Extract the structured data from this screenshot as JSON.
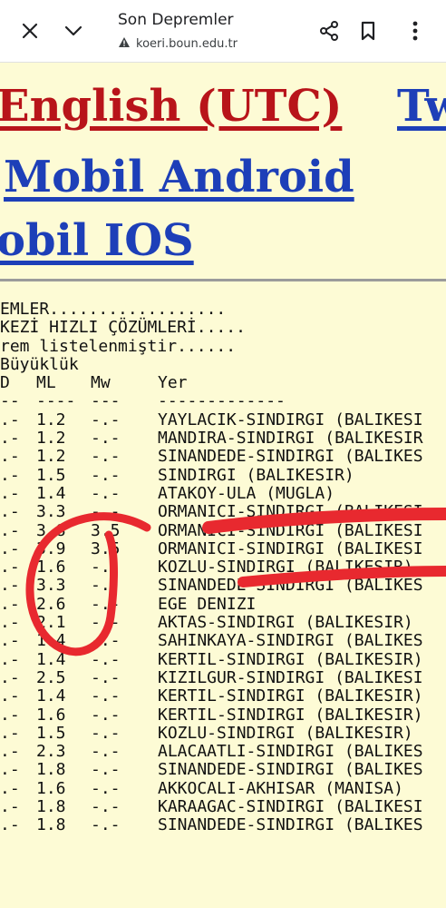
{
  "browser": {
    "page_title": "Son Depremler",
    "url": "koeri.boun.edu.tr",
    "icons": [
      "close-icon",
      "chevron-down-icon",
      "warning-icon",
      "share-icon",
      "bookmark-icon",
      "more-vert-icon"
    ]
  },
  "links": {
    "english": "English (UTC)",
    "twitter_partial": "Tw",
    "mobil_android": "Mobil Android",
    "mobil_ios": "obil IOS"
  },
  "listing": {
    "header_lines": [
      "EMLER..................",
      "KEZİ HIZLI ÇÖZÜMLERİ.....",
      "rem listelenmiştir......",
      "Büyüklük"
    ],
    "columns": {
      "d": "D",
      "ml": "ML",
      "mw": "Mw",
      "place": "Yer"
    },
    "rule": {
      "d": "--",
      "ml": "----",
      "mw": "---",
      "place": "-------------"
    },
    "rows": [
      {
        "d": ".-",
        "ml": "1.2",
        "mw": "-.-",
        "place": "YAYLACIK-SINDIRGI (BALIKESI"
      },
      {
        "d": ".-",
        "ml": "1.2",
        "mw": "-.-",
        "place": "MANDIRA-SINDIRGI (BALIKESIR"
      },
      {
        "d": ".-",
        "ml": "1.2",
        "mw": "-.-",
        "place": "SINANDEDE-SINDIRGI (BALIKES"
      },
      {
        "d": ".-",
        "ml": "1.5",
        "mw": "-.-",
        "place": "SINDIRGI (BALIKESIR)"
      },
      {
        "d": ".-",
        "ml": "1.4",
        "mw": "-.-",
        "place": "ATAKOY-ULA (MUGLA)"
      },
      {
        "d": ".-",
        "ml": "3.3",
        "mw": "-.-",
        "place": "ORMANICI-SINDIRGI (BALIKESI"
      },
      {
        "d": ".-",
        "ml": "3.8",
        "mw": "3.5",
        "place": "ORMANICI-SINDIRGI (BALIKESI"
      },
      {
        "d": ".-",
        "ml": "3.9",
        "mw": "3.5",
        "place": "ORMANICI-SINDIRGI (BALIKESI"
      },
      {
        "d": ".-",
        "ml": "1.6",
        "mw": "-.-",
        "place": "KOZLU-SINDIRGI (BALIKESIR)"
      },
      {
        "d": ".-",
        "ml": "3.3",
        "mw": "-.-",
        "place": "SINANDEDE-SINDIRGI (BALIKES"
      },
      {
        "d": ".-",
        "ml": "2.6",
        "mw": "-.-",
        "place": "EGE DENIZI"
      },
      {
        "d": ".-",
        "ml": "2.1",
        "mw": "-.-",
        "place": "AKTAS-SINDIRGI (BALIKESIR)"
      },
      {
        "d": ".-",
        "ml": "1.4",
        "mw": "-.-",
        "place": "SAHINKAYA-SINDIRGI (BALIKES"
      },
      {
        "d": ".-",
        "ml": "1.4",
        "mw": "-.-",
        "place": "KERTIL-SINDIRGI (BALIKESIR)"
      },
      {
        "d": ".-",
        "ml": "2.5",
        "mw": "-.-",
        "place": "KIZILGUR-SINDIRGI (BALIKESI"
      },
      {
        "d": ".-",
        "ml": "1.4",
        "mw": "-.-",
        "place": "KERTIL-SINDIRGI (BALIKESIR)"
      },
      {
        "d": ".-",
        "ml": "1.6",
        "mw": "-.-",
        "place": "KERTIL-SINDIRGI (BALIKESIR)"
      },
      {
        "d": ".-",
        "ml": "1.5",
        "mw": "-.-",
        "place": "KOZLU-SINDIRGI (BALIKESIR)"
      },
      {
        "d": ".-",
        "ml": "2.3",
        "mw": "-.-",
        "place": "ALACAATLI-SINDIRGI (BALIKES"
      },
      {
        "d": ".-",
        "ml": "1.8",
        "mw": "-.-",
        "place": "SINANDEDE-SINDIRGI (BALIKES"
      },
      {
        "d": ".-",
        "ml": "1.6",
        "mw": "-.-",
        "place": "AKKOCALI-AKHISAR (MANISA)"
      },
      {
        "d": ".-",
        "ml": "1.8",
        "mw": "-.-",
        "place": "KARAAGAC-SINDIRGI (BALIKESI"
      },
      {
        "d": ".-",
        "ml": "1.8",
        "mw": "-.-",
        "place": "SINANDEDE-SINDIRGI (BALIKES"
      }
    ]
  },
  "annotation": {
    "stroke_color": "#e8292f",
    "page_background": "#fdfbd5",
    "link_red": "#b8141a",
    "link_blue": "#1d3fb8"
  }
}
